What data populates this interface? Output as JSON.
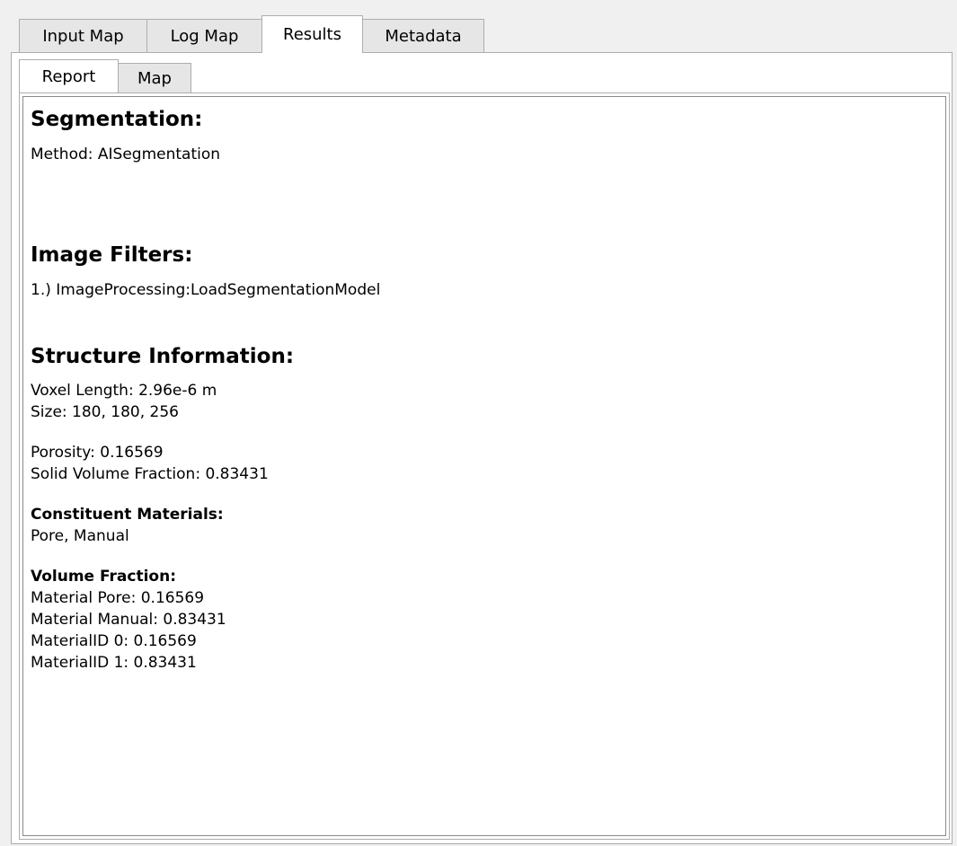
{
  "tabs_top": [
    "Input Map",
    "Log Map",
    "Results",
    "Metadata"
  ],
  "tabs_top_active": "Results",
  "tabs_sub": [
    "Report",
    "Map"
  ],
  "tabs_sub_active": "Report",
  "report": {
    "segmentation": {
      "heading": "Segmentation:",
      "method": "Method: AISegmentation"
    },
    "image_filters": {
      "heading": "Image Filters:",
      "item_1": "1.) ImageProcessing:LoadSegmentationModel"
    },
    "structure": {
      "heading": "Structure Information:",
      "voxel_length": "Voxel Length: 2.96e-6 m",
      "size": "Size: 180, 180, 256",
      "porosity": "Porosity: 0.16569",
      "solid_volume_fraction": "Solid Volume Fraction: 0.83431",
      "constituent_heading": "Constituent Materials:",
      "constituent_list": "Pore, Manual",
      "volume_fraction_heading": "Volume Fraction:",
      "material_pore": "Material Pore: 0.16569",
      "material_manual": "Material Manual: 0.83431",
      "material_id_0": "MaterialID 0: 0.16569",
      "material_id_1": "MaterialID 1: 0.83431"
    }
  }
}
